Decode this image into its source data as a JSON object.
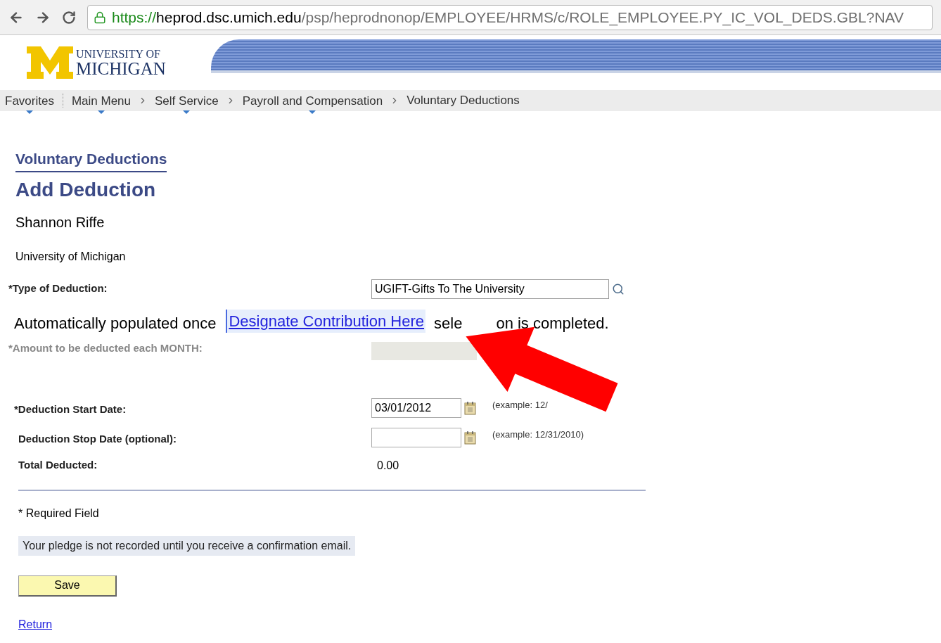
{
  "browser": {
    "url_scheme": "https://",
    "url_host": "heprod.dsc.umich.edu",
    "url_path": "/psp/heprodnonop/EMPLOYEE/HRMS/c/ROLE_EMPLOYEE.PY_IC_VOL_DEDS.GBL?NAV"
  },
  "logo": {
    "line1": "UNIVERSITY OF",
    "line2": "MICHIGAN"
  },
  "nav": [
    {
      "label": "Favorites",
      "dropdown": true
    },
    {
      "label": "Main Menu",
      "dropdown": true
    },
    {
      "label": "Self Service",
      "dropdown": true
    },
    {
      "label": "Payroll and Compensation",
      "dropdown": true
    },
    {
      "label": "Voluntary Deductions",
      "dropdown": false
    }
  ],
  "page": {
    "breadcrumb_title": "Voluntary Deductions",
    "title": "Add Deduction",
    "employee": "Shannon Riffe",
    "company": "University of Michigan"
  },
  "type_field": {
    "label": "*Type of Deduction:",
    "value": "UGIFT-Gifts To The University"
  },
  "note": {
    "before": "Automatically populated once",
    "link": "Designate Contribution Here",
    "after_visible_1": "sele",
    "after_visible_2": "on is completed."
  },
  "amount_field": {
    "label": "*Amount to be deducted each MONTH:",
    "disabled": true
  },
  "date_fields": [
    {
      "label": "*Deduction Start Date:",
      "value": "03/01/2012",
      "hint": "(example: 12/"
    },
    {
      "label": "Deduction Stop Date (optional):",
      "hint": "(example: 12/31/2010)"
    }
  ],
  "total": {
    "label": "Total Deducted:",
    "value": "0.00"
  },
  "required_note": "* Required Field",
  "pledge_note": "Your pledge is not recorded until you receive a confirmation email.",
  "save_button": "Save",
  "return_link": "Return"
}
